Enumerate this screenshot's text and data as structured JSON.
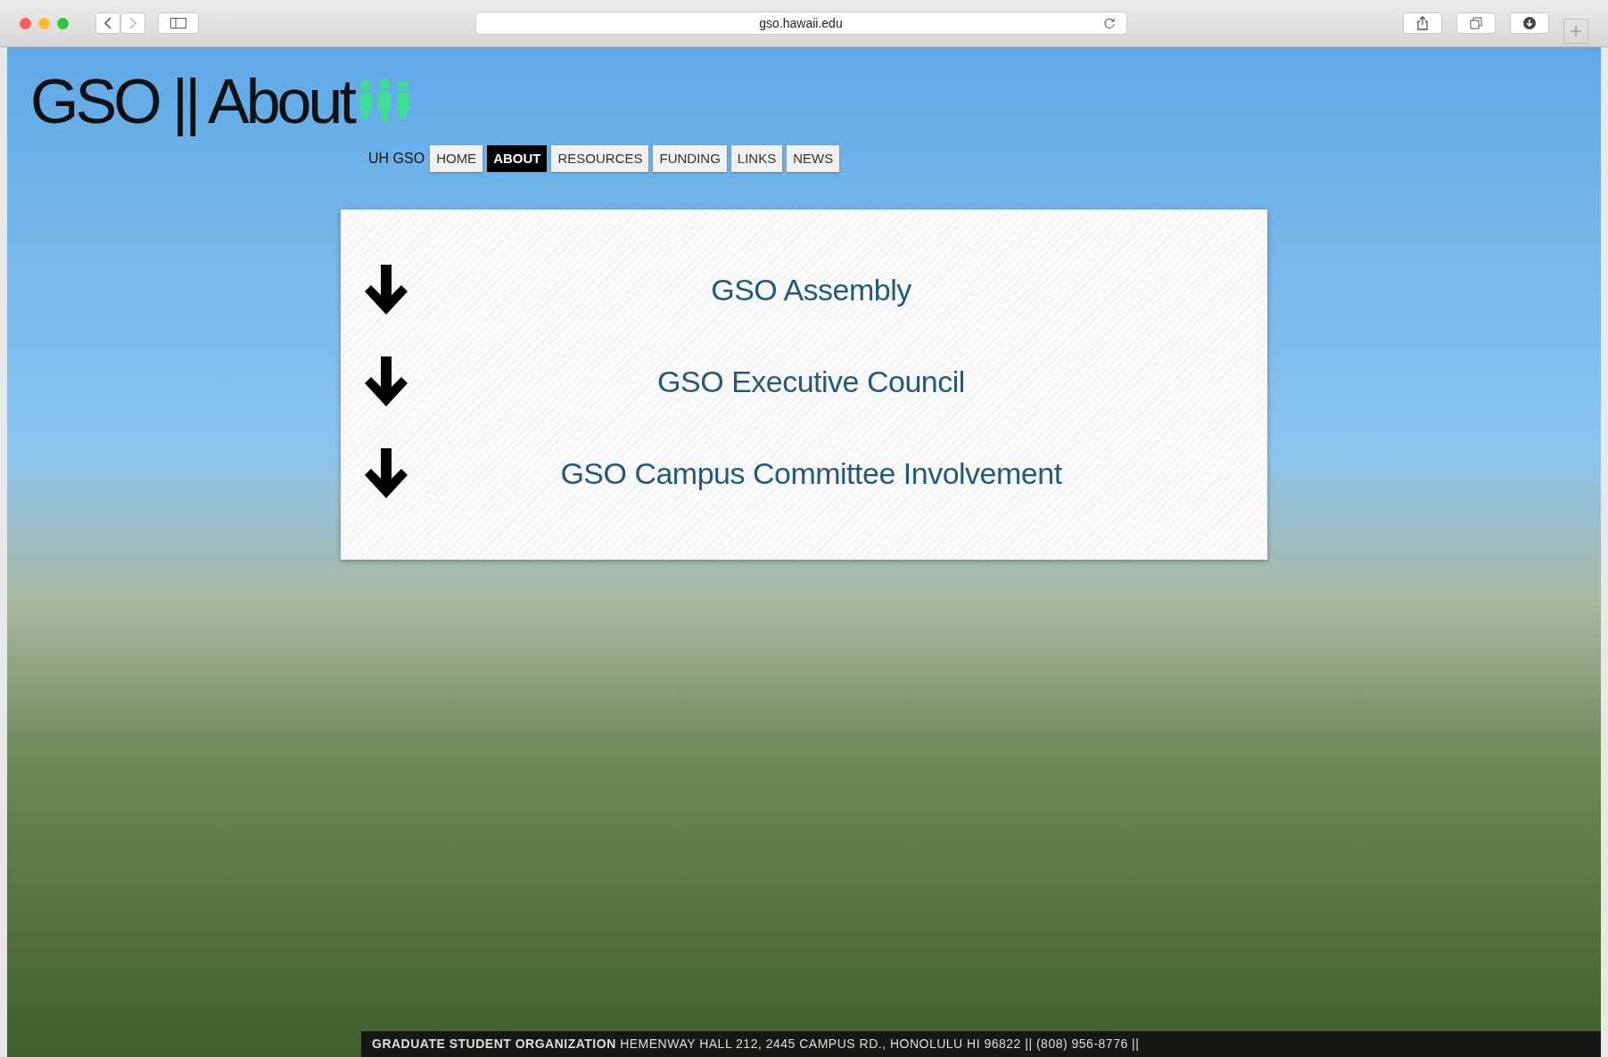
{
  "browser": {
    "url": "gso.hawaii.edu"
  },
  "site_title": "GSO || About",
  "nav": {
    "label": "UH GSO",
    "items": [
      {
        "label": "HOME",
        "selected": false
      },
      {
        "label": "ABOUT",
        "selected": true
      },
      {
        "label": "RESOURCES",
        "selected": false
      },
      {
        "label": "FUNDING",
        "selected": false
      },
      {
        "label": "LINKS",
        "selected": false
      },
      {
        "label": "NEWS",
        "selected": false
      }
    ]
  },
  "sections": [
    {
      "title": "GSO Assembly"
    },
    {
      "title": "GSO Executive Council"
    },
    {
      "title": "GSO Campus Committee Involvement"
    }
  ],
  "footer": "**GRADUATE STUDENT ORGANIZATION** HEMENWAY HALL 212, 2445 CAMPUS RD., HONOLULU HI 96822 || (808) 956-8776 ||"
}
